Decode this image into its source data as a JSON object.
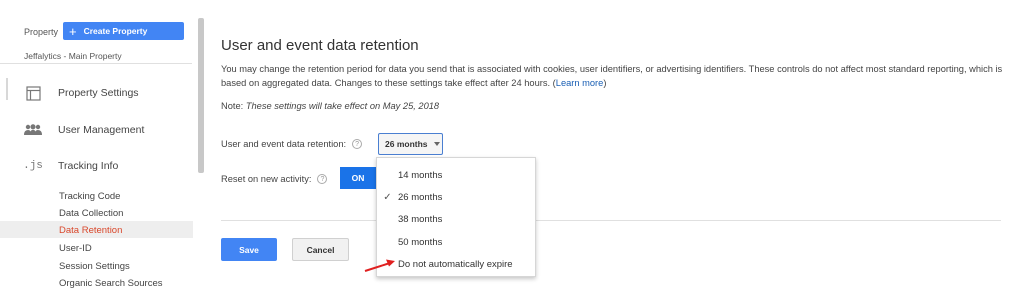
{
  "sidebar": {
    "property_label": "Property",
    "create_property_label": "Create Property",
    "property_name": "Jeffalytics - Main Property",
    "nav": [
      {
        "label": "Property Settings",
        "icon": "document-icon"
      },
      {
        "label": "User Management",
        "icon": "people-icon"
      },
      {
        "label": "Tracking Info",
        "icon": ".js"
      }
    ],
    "sub_items": [
      {
        "label": "Tracking Code"
      },
      {
        "label": "Data Collection"
      },
      {
        "label": "Data Retention",
        "active": true
      },
      {
        "label": "User-ID"
      },
      {
        "label": "Session Settings"
      },
      {
        "label": "Organic Search Sources"
      }
    ]
  },
  "main": {
    "title": "User and event data retention",
    "description": "You may change the retention period for data you send that is associated with cookies, user identifiers, or advertising identifiers. These controls do not affect most standard reporting, which is based on aggregated data. Changes to these settings take effect after 24 hours.",
    "learn_more_prefix": "(",
    "learn_more_link": "Learn more",
    "learn_more_suffix": ")",
    "note_label": "Note:",
    "note_text": "These settings will take effect on May 25, 2018",
    "retention_label": "User and event data retention:",
    "retention_value": "26 months",
    "reset_label": "Reset on new activity:",
    "toggle_label": "ON",
    "save_label": "Save",
    "cancel_label": "Cancel",
    "help_glyph": "?"
  },
  "dropdown": {
    "options": [
      {
        "label": "14 months",
        "selected": false
      },
      {
        "label": "26 months",
        "selected": true
      },
      {
        "label": "38 months",
        "selected": false
      },
      {
        "label": "50 months",
        "selected": false
      },
      {
        "label": "Do not automatically expire",
        "selected": false
      }
    ],
    "check_glyph": "✓"
  },
  "colors": {
    "accent": "#4285f4",
    "active_item": "#d9472b",
    "annotation_arrow": "#e02020"
  }
}
